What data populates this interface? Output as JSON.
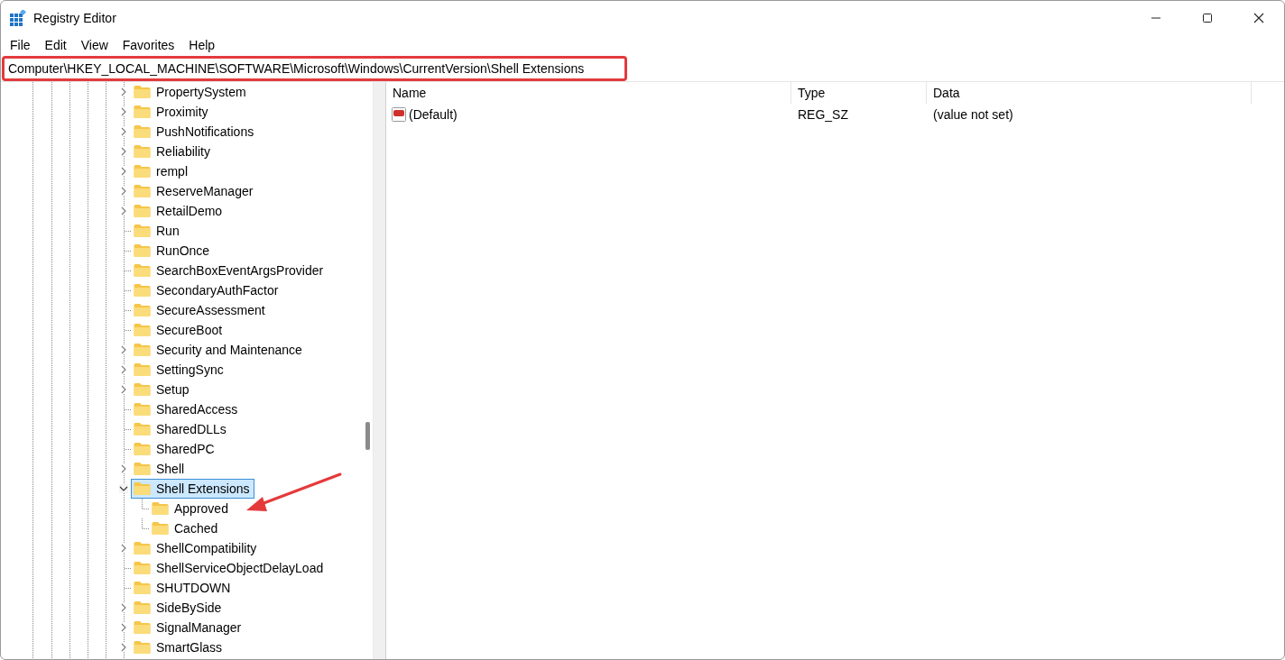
{
  "window": {
    "title": "Registry Editor"
  },
  "menu": [
    "File",
    "Edit",
    "View",
    "Favorites",
    "Help"
  ],
  "address_bar": {
    "value": "Computer\\HKEY_LOCAL_MACHINE\\SOFTWARE\\Microsoft\\Windows\\CurrentVersion\\Shell Extensions",
    "highlighted": true
  },
  "tree": [
    {
      "label": "PropertySystem",
      "expandable": true,
      "expanded": false,
      "selected": false
    },
    {
      "label": "Proximity",
      "expandable": true,
      "expanded": false,
      "selected": false
    },
    {
      "label": "PushNotifications",
      "expandable": true,
      "expanded": false,
      "selected": false
    },
    {
      "label": "Reliability",
      "expandable": true,
      "expanded": false,
      "selected": false
    },
    {
      "label": "rempl",
      "expandable": true,
      "expanded": false,
      "selected": false
    },
    {
      "label": "ReserveManager",
      "expandable": true,
      "expanded": false,
      "selected": false
    },
    {
      "label": "RetailDemo",
      "expandable": true,
      "expanded": false,
      "selected": false
    },
    {
      "label": "Run",
      "expandable": false,
      "selected": false
    },
    {
      "label": "RunOnce",
      "expandable": false,
      "selected": false
    },
    {
      "label": "SearchBoxEventArgsProvider",
      "expandable": false,
      "selected": false
    },
    {
      "label": "SecondaryAuthFactor",
      "expandable": false,
      "selected": false
    },
    {
      "label": "SecureAssessment",
      "expandable": false,
      "selected": false
    },
    {
      "label": "SecureBoot",
      "expandable": false,
      "selected": false
    },
    {
      "label": "Security and Maintenance",
      "expandable": true,
      "expanded": false,
      "selected": false
    },
    {
      "label": "SettingSync",
      "expandable": true,
      "expanded": false,
      "selected": false
    },
    {
      "label": "Setup",
      "expandable": true,
      "expanded": false,
      "selected": false
    },
    {
      "label": "SharedAccess",
      "expandable": false,
      "selected": false
    },
    {
      "label": "SharedDLLs",
      "expandable": false,
      "selected": false
    },
    {
      "label": "SharedPC",
      "expandable": false,
      "selected": false
    },
    {
      "label": "Shell",
      "expandable": true,
      "expanded": false,
      "selected": false
    },
    {
      "label": "Shell Extensions",
      "expandable": true,
      "expanded": true,
      "selected": true,
      "children": [
        {
          "label": "Approved",
          "expandable": false,
          "selected": false
        },
        {
          "label": "Cached",
          "expandable": false,
          "selected": false
        }
      ]
    },
    {
      "label": "ShellCompatibility",
      "expandable": true,
      "expanded": false,
      "selected": false
    },
    {
      "label": "ShellServiceObjectDelayLoad",
      "expandable": false,
      "selected": false
    },
    {
      "label": "SHUTDOWN",
      "expandable": false,
      "selected": false
    },
    {
      "label": "SideBySide",
      "expandable": true,
      "expanded": false,
      "selected": false
    },
    {
      "label": "SignalManager",
      "expandable": true,
      "expanded": false,
      "selected": false
    },
    {
      "label": "SmartGlass",
      "expandable": true,
      "expanded": false,
      "selected": false
    }
  ],
  "values": {
    "columns": [
      "Name",
      "Type",
      "Data"
    ],
    "rows": [
      {
        "name": "(Default)",
        "type": "REG_SZ",
        "data": "(value not set)"
      }
    ]
  }
}
